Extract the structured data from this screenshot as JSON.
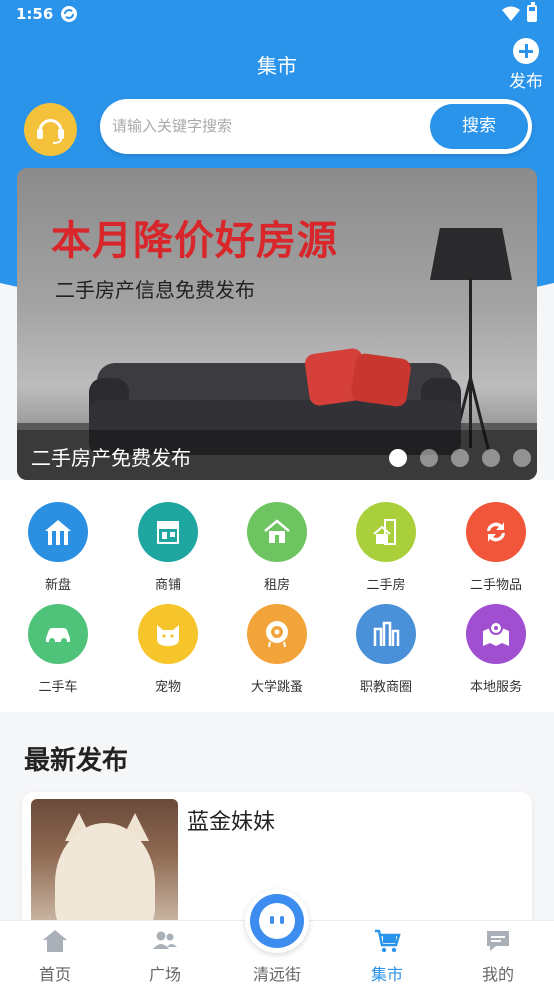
{
  "status_bar": {
    "time": "1:56"
  },
  "header": {
    "title": "集市",
    "publish_label": "发布"
  },
  "search": {
    "placeholder": "请输入关键字搜索",
    "button_label": "搜索"
  },
  "banner": {
    "headline": "本月降价好房源",
    "subline": "二手房产信息免费发布",
    "caption": "二手房产免费发布",
    "slide_count": 5,
    "active_slide": 1
  },
  "categories": [
    {
      "label": "新盘",
      "icon": "new-building-icon",
      "color": "#2b8fe2"
    },
    {
      "label": "商铺",
      "icon": "shop-icon",
      "color": "#1fa6a0"
    },
    {
      "label": "租房",
      "icon": "rent-house-icon",
      "color": "#6dc461"
    },
    {
      "label": "二手房",
      "icon": "second-hand-house-icon",
      "color": "#a9cf3a"
    },
    {
      "label": "二手物品",
      "icon": "second-hand-goods-icon",
      "color": "#f2563a"
    },
    {
      "label": "二手车",
      "icon": "car-icon",
      "color": "#4fc37a"
    },
    {
      "label": "宠物",
      "icon": "pet-cat-icon",
      "color": "#f6c52c"
    },
    {
      "label": "大学跳蚤",
      "icon": "flea-market-eye-icon",
      "color": "#f2a43a"
    },
    {
      "label": "职教商圈",
      "icon": "vocational-district-icon",
      "color": "#4a90d8"
    },
    {
      "label": "本地服务",
      "icon": "local-service-map-icon",
      "color": "#a04fd0"
    }
  ],
  "latest": {
    "title": "最新发布",
    "items": [
      {
        "name": "蓝金妹妹"
      }
    ]
  },
  "tabbar": {
    "items": [
      {
        "label": "首页",
        "icon": "home-icon"
      },
      {
        "label": "广场",
        "icon": "people-icon"
      },
      {
        "label": "清远街",
        "icon": "robot-face-icon"
      },
      {
        "label": "集市",
        "icon": "cart-icon"
      },
      {
        "label": "我的",
        "icon": "message-icon"
      }
    ],
    "active": "集市"
  },
  "colors": {
    "primary": "#2a93ea",
    "headline_red": "#d8262a",
    "service_yellow": "#f3c13a"
  }
}
